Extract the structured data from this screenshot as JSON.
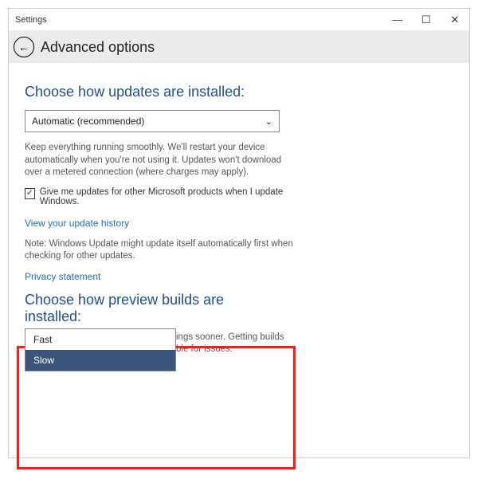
{
  "window": {
    "title": "Settings"
  },
  "sysbuttons": {
    "min": "—",
    "max": "☐",
    "close": "✕"
  },
  "header": {
    "title": "Advanced options",
    "back_glyph": "←"
  },
  "updates": {
    "heading": "Choose how updates are installed:",
    "select_value": "Automatic (recommended)",
    "chevron": "⌄",
    "description": "Keep everything running smoothly. We'll restart your device automatically when you're not using it. Updates won't download over a metered connection (where charges may apply).",
    "checkbox_checked_glyph": "✓",
    "checkbox_label": "Give me updates for other Microsoft products when I update Windows.",
    "history_link": "View your update history",
    "note": "Note: Windows Update might update itself automatically first when checking for other updates.",
    "privacy_link": "Privacy statement"
  },
  "preview": {
    "heading": "Choose how preview builds are installed:",
    "behind_text_right": "ings sooner. Getting builds",
    "behind_text_right2": "ble for issues.",
    "options": [
      "Fast",
      "Slow"
    ],
    "selected_index": 1
  }
}
